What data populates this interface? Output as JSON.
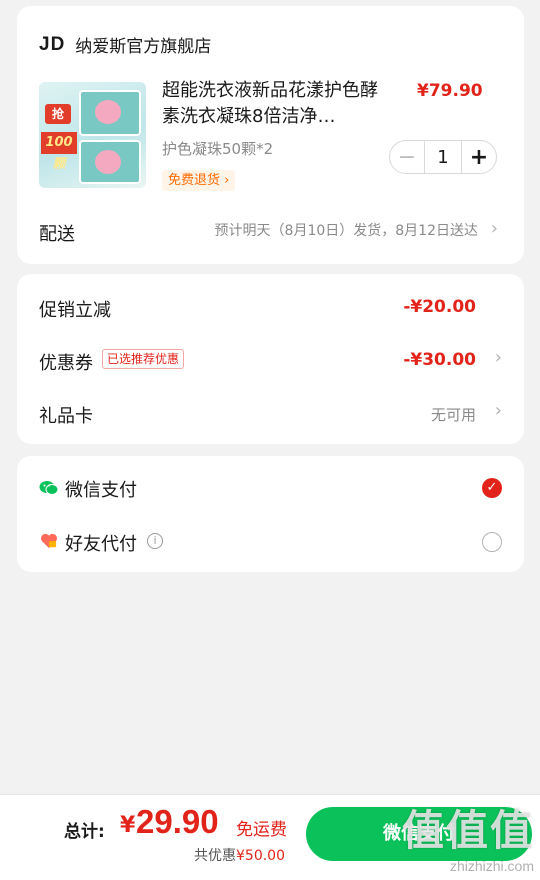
{
  "store": {
    "logo": "JD",
    "name": "纳爱斯官方旗舰店"
  },
  "product": {
    "title": "超能洗衣液新品花漾护色酵素洗衣凝珠8倍洁净…",
    "price": "¥79.90",
    "spec": "护色凝珠50颗*2",
    "free_return": "免费退货",
    "quantity": "1",
    "thumb_tag1": "抢",
    "thumb_tag2": "100颗"
  },
  "delivery": {
    "label": "配送",
    "info": "预计明天（8月10日）发货，8月12日送达"
  },
  "promo": {
    "discount_label": "促销立减",
    "discount_value": "-¥20.00",
    "coupon_label": "优惠券",
    "coupon_tag": "已选推荐优惠",
    "coupon_value": "-¥30.00",
    "giftcard_label": "礼品卡",
    "giftcard_value": "无可用"
  },
  "payment": {
    "wechat_label": "微信支付",
    "friend_label": "好友代付"
  },
  "bottom": {
    "total_label": "总计:",
    "currency": "¥",
    "amount": "29.90",
    "free_shipping": "免运费",
    "saved_prefix": "共优惠",
    "saved_amount": "¥50.00",
    "pay_button": "微信支付"
  },
  "watermark": {
    "main": "值值值",
    "sub": "zhizhizhi.com"
  },
  "colors": {
    "accent_red": "#e2231a",
    "wechat_green": "#0bc25a",
    "orange": "#ff6a00"
  }
}
